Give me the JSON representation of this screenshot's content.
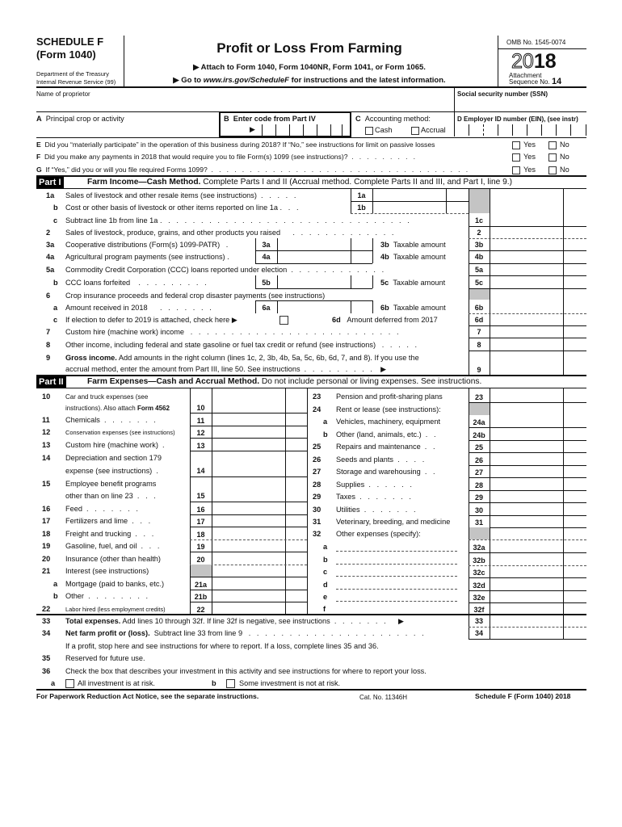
{
  "header": {
    "schedule": "SCHEDULE F",
    "form": "(Form 1040)",
    "dept_line1": "Department of the Treasury",
    "dept_line2": "Internal Revenue Service (99)",
    "title": "Profit or Loss From Farming",
    "attach_line": "▶ Attach to Form 1040, Form 1040NR, Form 1041, or Form 1065.",
    "goto_prefix": "▶ Go to ",
    "goto_url": "www.irs.gov/ScheduleF",
    "goto_suffix": " for instructions and the latest information.",
    "omb": "OMB No. 1545-0074",
    "year_outline": "20",
    "year_bold": "18",
    "attachment": "Attachment",
    "sequence_label": "Sequence No.",
    "sequence_no": "14"
  },
  "identity": {
    "name_label": "Name of proprietor",
    "name_value": "",
    "ssn_label": "Social security number (SSN)",
    "ssn_value": "",
    "a_letter": "A",
    "a_label": "Principal crop or activity",
    "b_letter": "B",
    "b_label": "Enter code from Part IV",
    "c_letter": "C",
    "c_label": "Accounting method:",
    "c_cash": "Cash",
    "c_accrual": "Accrual",
    "d_label": "D Employer ID number (EIN), (see instr)"
  },
  "questions": [
    {
      "letter": "E",
      "text": "Did you “materially participate” in the operation of this business during 2018? If “No,” see instructions for limit on passive losses",
      "yes": "Yes",
      "no": "No"
    },
    {
      "letter": "F",
      "text": "Did you make any payments in 2018 that would require you to file Form(s) 1099 (see instructions)?",
      "yes": "Yes",
      "no": "No"
    },
    {
      "letter": "G",
      "text": "If “Yes,” did you or will you file required Forms 1099?",
      "yes": "Yes",
      "no": "No"
    }
  ],
  "part1": {
    "badge": "Part I",
    "title": "Farm Income—Cash Method.",
    "subtitle": "Complete Parts I and II (Accrual method. Complete Parts II and III, and Part I, line 9.)",
    "lines": {
      "l1a": {
        "num": "1a",
        "text": "Sales of livestock and other resale items (see instructions)",
        "box": "1a"
      },
      "l1b": {
        "num": "b",
        "text": "Cost or other basis of livestock or other items reported on line 1a",
        "box": "1b"
      },
      "l1c": {
        "num": "c",
        "text": "Subtract line 1b from line 1a",
        "box": "1c"
      },
      "l2": {
        "num": "2",
        "text": "Sales of livestock, produce, grains, and other products you raised",
        "box": "2"
      },
      "l3a": {
        "num": "3a",
        "text": "Cooperative distributions (Form(s) 1099-PATR)",
        "box": "3a",
        "b_num": "3b",
        "b_text": "Taxable amount",
        "b_box": "3b"
      },
      "l4a": {
        "num": "4a",
        "text": "Agricultural program payments (see instructions)",
        "box": "4a",
        "b_num": "4b",
        "b_text": "Taxable amount",
        "b_box": "4b"
      },
      "l5a": {
        "num": "5a",
        "text": "Commodity Credit Corporation (CCC) loans reported under election",
        "box": "5a"
      },
      "l5b": {
        "num": "b",
        "text": "CCC loans forfeited",
        "box": "5b",
        "c_num": "5c",
        "c_text": "Taxable amount",
        "c_box": "5c"
      },
      "l6": {
        "num": "6",
        "text": "Crop insurance proceeds and federal crop disaster payments (see instructions)"
      },
      "l6a": {
        "num": "a",
        "text": "Amount received in 2018",
        "box": "6a",
        "b_num": "6b",
        "b_text": "Taxable amount",
        "b_box": "6b"
      },
      "l6c": {
        "num": "c",
        "text": "If election to defer to 2019 is attached, check here ▶",
        "d_num": "6d",
        "d_text": "Amount deferred from 2017",
        "d_box": "6d"
      },
      "l7": {
        "num": "7",
        "text": "Custom hire (machine work) income",
        "box": "7"
      },
      "l8": {
        "num": "8",
        "text": "Other income, including federal and state gasoline or fuel tax credit or refund (see instructions)",
        "box": "8"
      },
      "l9": {
        "num": "9",
        "bold": "Gross income.",
        "text1": "Add amounts in the right column (lines 1c, 2, 3b, 4b, 5a, 5c, 6b, 6d, 7, and 8). If you use the",
        "text2": "accrual method, enter the amount from Part III, line 50. See instructions",
        "box": "9"
      }
    }
  },
  "part2": {
    "badge": "Part II",
    "title": "Farm Expenses—Cash and Accrual Method.",
    "subtitle": "Do not include personal or living expenses. See instructions.",
    "left": [
      {
        "num": "10",
        "t1": "Car and truck expenses (see",
        "t2a": "instructions). Also attach ",
        "t2b": "Form 4562",
        "box": "10"
      },
      {
        "num": "11",
        "text": "Chemicals",
        "box": "11"
      },
      {
        "num": "12",
        "text": "Conservation expenses (see instructions)",
        "box": "12"
      },
      {
        "num": "13",
        "text": "Custom hire (machine work)",
        "box": "13"
      },
      {
        "num": "14",
        "t1": "Depreciation and section 179",
        "t2": "expense (see instructions)",
        "box": "14"
      },
      {
        "num": "15",
        "t1": "Employee benefit programs",
        "t2": "other than on line 23",
        "box": "15"
      },
      {
        "num": "16",
        "text": "Feed",
        "box": "16"
      },
      {
        "num": "17",
        "text": "Fertilizers and lime",
        "box": "17"
      },
      {
        "num": "18",
        "text": "Freight and trucking",
        "box": "18"
      },
      {
        "num": "19",
        "text": "Gasoline, fuel, and oil",
        "box": "19"
      },
      {
        "num": "20",
        "text": "Insurance (other than health)",
        "box": "20"
      },
      {
        "num": "21",
        "text": "Interest (see instructions)"
      },
      {
        "num": "a",
        "text": "Mortgage (paid to banks, etc.)",
        "box": "21a"
      },
      {
        "num": "b",
        "text": "Other",
        "box": "21b"
      },
      {
        "num": "22",
        "text": "Labor hired (less employment credits)",
        "box": "22"
      }
    ],
    "right": [
      {
        "num": "23",
        "text": "Pension and profit-sharing plans",
        "box": "23"
      },
      {
        "num": "24",
        "text": "Rent or lease (see instructions):"
      },
      {
        "num": "a",
        "text": "Vehicles, machinery, equipment",
        "box": "24a"
      },
      {
        "num": "b",
        "text": "Other (land, animals, etc.)",
        "box": "24b"
      },
      {
        "num": "25",
        "text": "Repairs and maintenance",
        "box": "25"
      },
      {
        "num": "26",
        "text": "Seeds and plants",
        "box": "26"
      },
      {
        "num": "27",
        "text": "Storage and warehousing",
        "box": "27"
      },
      {
        "num": "28",
        "text": "Supplies",
        "box": "28"
      },
      {
        "num": "29",
        "text": "Taxes",
        "box": "29"
      },
      {
        "num": "30",
        "text": "Utilities",
        "box": "30"
      },
      {
        "num": "31",
        "text": "Veterinary, breeding, and medicine",
        "box": "31"
      },
      {
        "num": "32",
        "text": "Other expenses (specify):"
      },
      {
        "num": "a",
        "text": "",
        "box": "32a"
      },
      {
        "num": "b",
        "text": "",
        "box": "32b"
      },
      {
        "num": "c",
        "text": "",
        "box": "32c"
      },
      {
        "num": "d",
        "text": "",
        "box": "32d"
      },
      {
        "num": "e",
        "text": "",
        "box": "32e"
      },
      {
        "num": "f",
        "text": "",
        "box": "32f"
      }
    ],
    "l33": {
      "num": "33",
      "bold": "Total expenses.",
      "text": "Add lines 10 through 32f. If line 32f is negative, see instructions",
      "box": "33"
    },
    "l34": {
      "num": "34",
      "bold": "Net farm profit or (loss).",
      "text": "Subtract line 33 from line 9",
      "box": "34"
    },
    "l34_note": "If a profit, stop here and see instructions for where to report. If a loss, complete lines 35 and 36.",
    "l35": {
      "num": "35",
      "text": "Reserved for future use."
    },
    "l36": {
      "num": "36",
      "text": "Check the box that describes your investment in this activity and see instructions for where to report your loss."
    },
    "l36a": {
      "letter": "a",
      "text": "All investment is at risk."
    },
    "l36b": {
      "letter": "b",
      "text": "Some investment is not at risk."
    }
  },
  "footer": {
    "left": "For Paperwork Reduction Act Notice, see the separate instructions.",
    "center": "Cat. No. 11346H",
    "right": "Schedule F (Form 1040) 2018"
  },
  "icons": {
    "arrow": "▶"
  }
}
